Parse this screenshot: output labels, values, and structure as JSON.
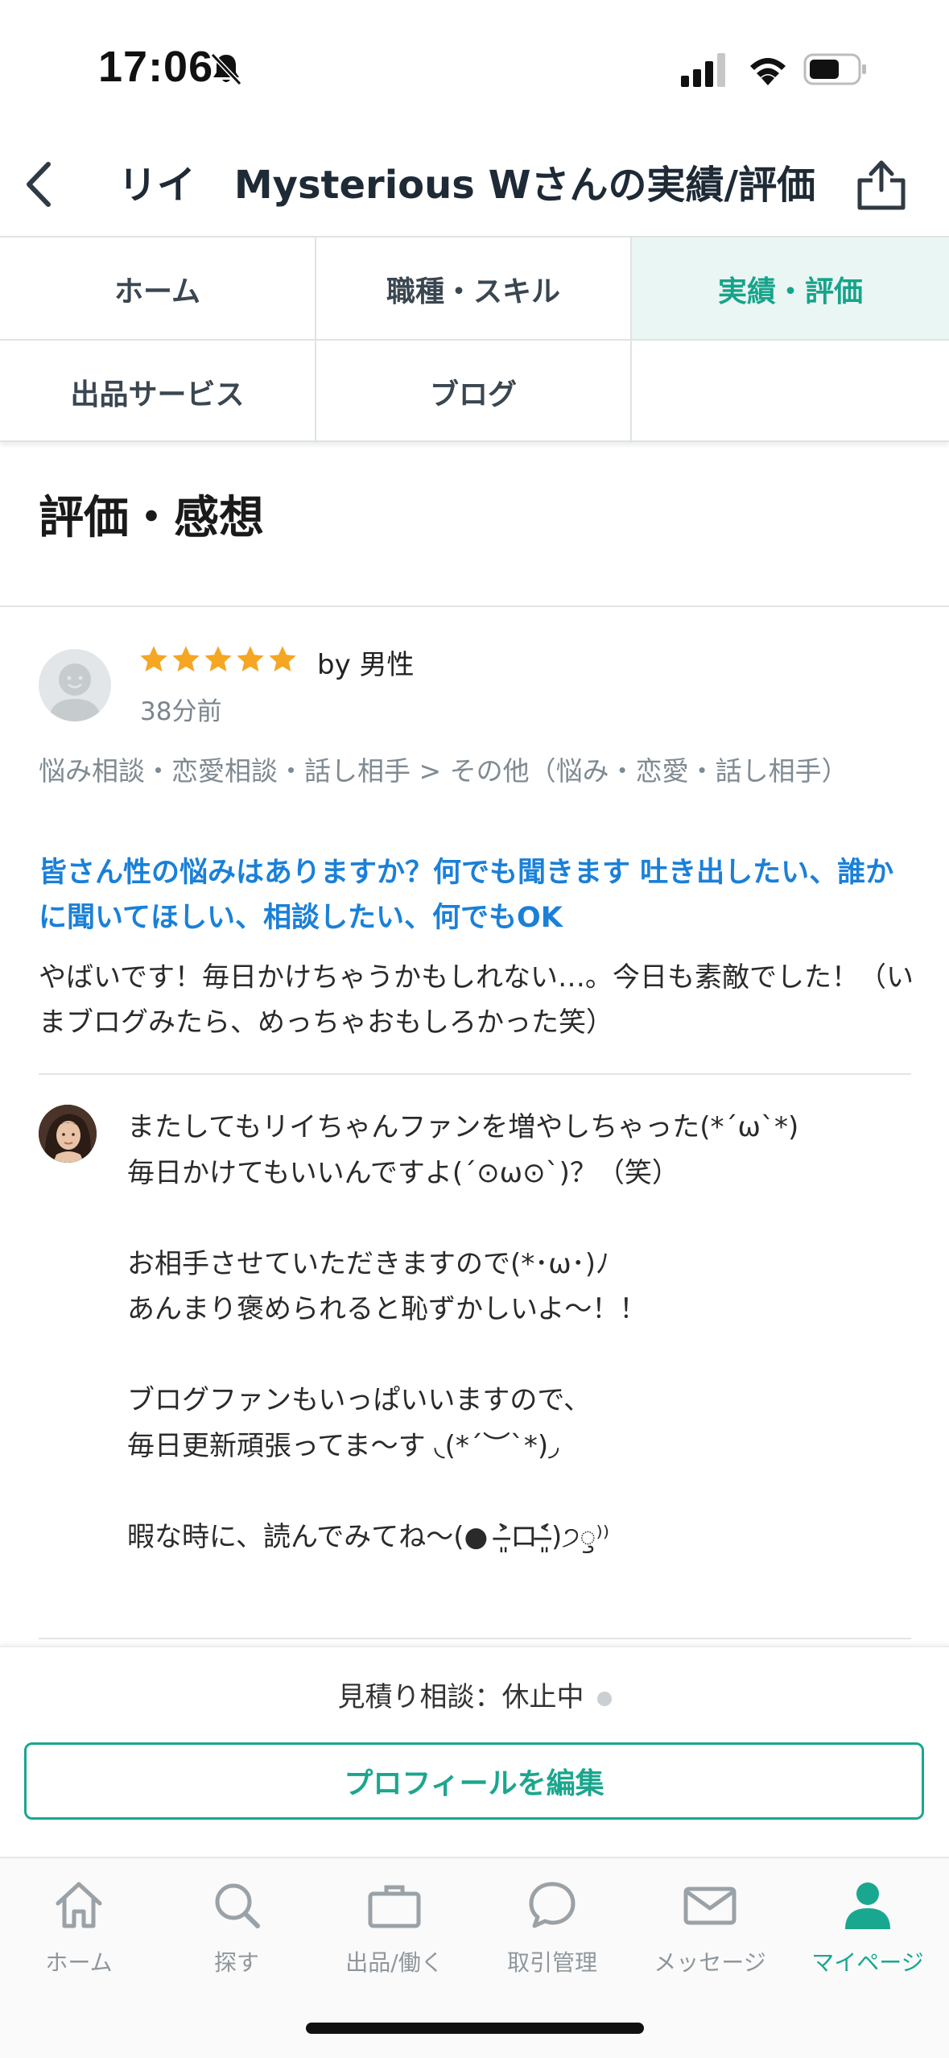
{
  "status_bar": {
    "time": "17:06"
  },
  "header": {
    "title": "リイ　Mysterious Wさんの実績/評価"
  },
  "tabs": [
    {
      "label": "ホーム",
      "active": false
    },
    {
      "label": "職種・スキル",
      "active": false
    },
    {
      "label": "実績・評価",
      "active": true
    },
    {
      "label": "出品サービス",
      "active": false
    },
    {
      "label": "ブログ",
      "active": false
    }
  ],
  "section": {
    "title": "評価・感想"
  },
  "review": {
    "rating": 5,
    "by": "by 男性",
    "time": "38分前",
    "category": "悩み相談・恋愛相談・話し相手 > その他（悩み・恋愛・話し相手）",
    "service_title": "皆さん性の悩みはありますか？何でも聞きます 吐き出したい、誰かに聞いてほしい、相談したい、何でもOK",
    "body": "やばいです！毎日かけちゃうかもしれない…。今日も素敵でした！（いまブログみたら、めっちゃおもしろかった笑）"
  },
  "reply": {
    "lines": [
      "またしてもリイちゃんファンを増やしちゃった(*´ω`*)",
      "毎日かけてもいいんですよ(´⊙ω⊙`)？（笑）",
      "",
      "お相手させていただきますので(*･ω･)ﾉ",
      "あんまり褒められると恥ずかしいよ〜！！",
      "",
      "ブログファンもいっぱいいますので、",
      "毎日更新頑張ってま〜す ︎◟(*´︶`*)◞",
      "",
      "暇な時に、読んでみてね〜(● ˃̶͈̀ロ˂̶͈́)੭ꠥ⁾⁾"
    ]
  },
  "estimate": {
    "label": "見積り相談：休止中"
  },
  "edit_profile": {
    "label": "プロフィールを編集"
  },
  "tabbar": [
    {
      "label": "ホーム",
      "icon": "home-icon",
      "active": false
    },
    {
      "label": "探す",
      "icon": "search-icon",
      "active": false
    },
    {
      "label": "出品/働く",
      "icon": "briefcase-icon",
      "active": false
    },
    {
      "label": "取引管理",
      "icon": "chat-bubble-icon",
      "active": false
    },
    {
      "label": "メッセージ",
      "icon": "mail-icon",
      "active": false
    },
    {
      "label": "マイページ",
      "icon": "person-icon",
      "active": true
    }
  ],
  "colors": {
    "accent": "#19a88f",
    "link": "#1a80d8",
    "star": "#f5a623",
    "active_tab_bg": "#eaf6f4"
  }
}
